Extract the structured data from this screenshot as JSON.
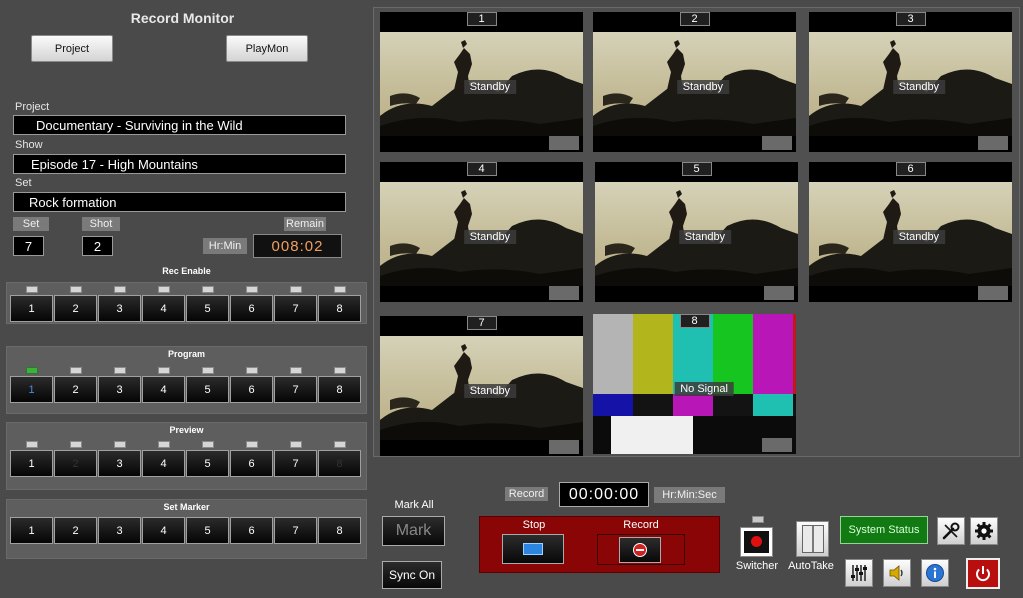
{
  "app": {
    "title": "Record Monitor"
  },
  "header": {
    "project_btn": "Project",
    "playmon_btn": "PlayMon"
  },
  "fields": {
    "project_label": "Project",
    "project_value": "Documentary - Surviving in the Wild",
    "show_label": "Show",
    "show_value": "Episode 17 - High Mountains",
    "set_label": "Set",
    "set_value": "Rock formation"
  },
  "counters": {
    "set_tag": "Set",
    "set_value": "7",
    "shot_tag": "Shot",
    "shot_value": "2",
    "remain_tag": "Remain",
    "hrmin_tag": "Hr:Min",
    "remain_value": "008:02"
  },
  "groups": {
    "rec_enable": {
      "title": "Rec Enable",
      "labels": [
        "1",
        "2",
        "3",
        "4",
        "5",
        "6",
        "7",
        "8"
      ],
      "leds": [
        false,
        false,
        false,
        false,
        false,
        false,
        false,
        false
      ]
    },
    "program": {
      "title": "Program",
      "labels": [
        "1",
        "2",
        "3",
        "4",
        "5",
        "6",
        "7",
        "8"
      ],
      "leds": [
        true,
        false,
        false,
        false,
        false,
        false,
        false,
        false
      ],
      "active": 0
    },
    "preview": {
      "title": "Preview",
      "labels": [
        "1",
        "2",
        "3",
        "4",
        "5",
        "6",
        "7",
        "8"
      ],
      "leds": [
        false,
        false,
        false,
        false,
        false,
        false,
        false,
        false
      ],
      "dim": [
        1,
        7
      ]
    },
    "set_marker": {
      "title": "Set Marker",
      "labels": [
        "1",
        "2",
        "3",
        "4",
        "5",
        "6",
        "7",
        "8"
      ]
    }
  },
  "monitors": [
    {
      "num": "1",
      "status": "Standby"
    },
    {
      "num": "2",
      "status": "Standby"
    },
    {
      "num": "3",
      "status": "Standby"
    },
    {
      "num": "4",
      "status": "Standby"
    },
    {
      "num": "5",
      "status": "Standby"
    },
    {
      "num": "6",
      "status": "Standby"
    },
    {
      "num": "7",
      "status": "Standby"
    },
    {
      "num": "8",
      "status": "No Signal"
    }
  ],
  "controls": {
    "mark_all_label": "Mark All",
    "mark_btn": "Mark",
    "sync_btn": "Sync On",
    "record_tag": "Record",
    "timecode": "00:00:00",
    "timecode_unit": "Hr:Min:Sec",
    "stop_label": "Stop",
    "record_label": "Record",
    "switcher_label": "Switcher",
    "autotake_label": "AutoTake",
    "system_status_btn": "System Status"
  },
  "icons": {
    "tools": "wrench-screwdriver-icon",
    "settings": "gear-icon",
    "mixer": "sliders-icon",
    "volume": "speaker-icon",
    "info": "info-icon",
    "power": "power-icon"
  }
}
